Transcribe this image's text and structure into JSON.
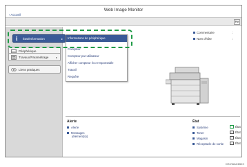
{
  "window": {
    "title": "Web Image Monitor",
    "back_link": "Accueil",
    "toolbar_button": "Re"
  },
  "sidebar": {
    "items": [
      {
        "label": "État/Information",
        "active": true
      },
      {
        "label": "Périphérique",
        "active": false
      },
      {
        "label": "Travaux/Paramétrage",
        "active": false
      },
      {
        "label": "Liens pratiques",
        "active": false
      }
    ],
    "hidden_text": "Périphérique"
  },
  "submenu": {
    "items": [
      {
        "label": "Informations de périphérique",
        "selected": true
      },
      {
        "label": "Compteur",
        "selected": false
      },
      {
        "label": "Compteur par utilisateur",
        "selected": false
      },
      {
        "label": "Afficher compteur éco-responsable",
        "selected": false
      },
      {
        "label": "Travail",
        "selected": false
      },
      {
        "label": "Requête",
        "selected": false
      }
    ]
  },
  "device_info": {
    "comment_label": "Commentaire",
    "host_label": "Nom d'hôte",
    "sep": ":"
  },
  "alert": {
    "header": "Alerte",
    "rows": [
      "Alerte",
      "Messages",
      "(élément(s))"
    ]
  },
  "status": {
    "header": "État",
    "rows": [
      {
        "label": "Système",
        "value": "État"
      },
      {
        "label": "Toner",
        "value": "État"
      },
      {
        "label": "Magasin",
        "value": "État"
      },
      {
        "label": "Réceptacle de sortie",
        "value": "État"
      }
    ]
  },
  "figure_code": "DSCWAC652X",
  "colors": {
    "accent": "#3a5a97",
    "callout": "#1f9b46",
    "sidebar_bg": "#d9d9d9"
  }
}
